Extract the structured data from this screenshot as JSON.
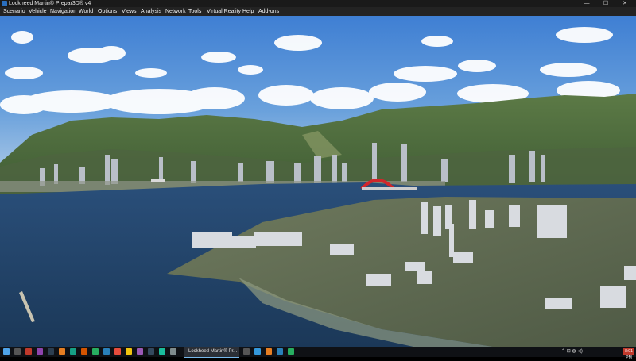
{
  "window": {
    "title": "Lockheed Martin® Prepar3D® v4",
    "controls": {
      "minimize": "—",
      "maximize": "☐",
      "close": "✕"
    }
  },
  "menu": [
    {
      "label": "Scenario"
    },
    {
      "label": "Vehicle"
    },
    {
      "label": "Navigation"
    },
    {
      "label": "World"
    },
    {
      "label": "Options"
    },
    {
      "label": "Views"
    },
    {
      "label": "Analysis"
    },
    {
      "label": "Network"
    },
    {
      "label": "Tools"
    },
    {
      "label": "Virtual Reality"
    },
    {
      "label": "Help"
    },
    {
      "label": "Add-ons"
    }
  ],
  "viewport": {
    "scene": "3D aerial view of coastal city with mountains, harbor, red arch bridge and artificial island"
  },
  "taskbar": {
    "start_icon": "windows-start-icon",
    "active_window_label": "Lockheed Martin® Pr...",
    "tray_notification": "8:01 PM",
    "colors": {
      "accent": "#76b9ed",
      "bar": "#0f1115"
    }
  }
}
